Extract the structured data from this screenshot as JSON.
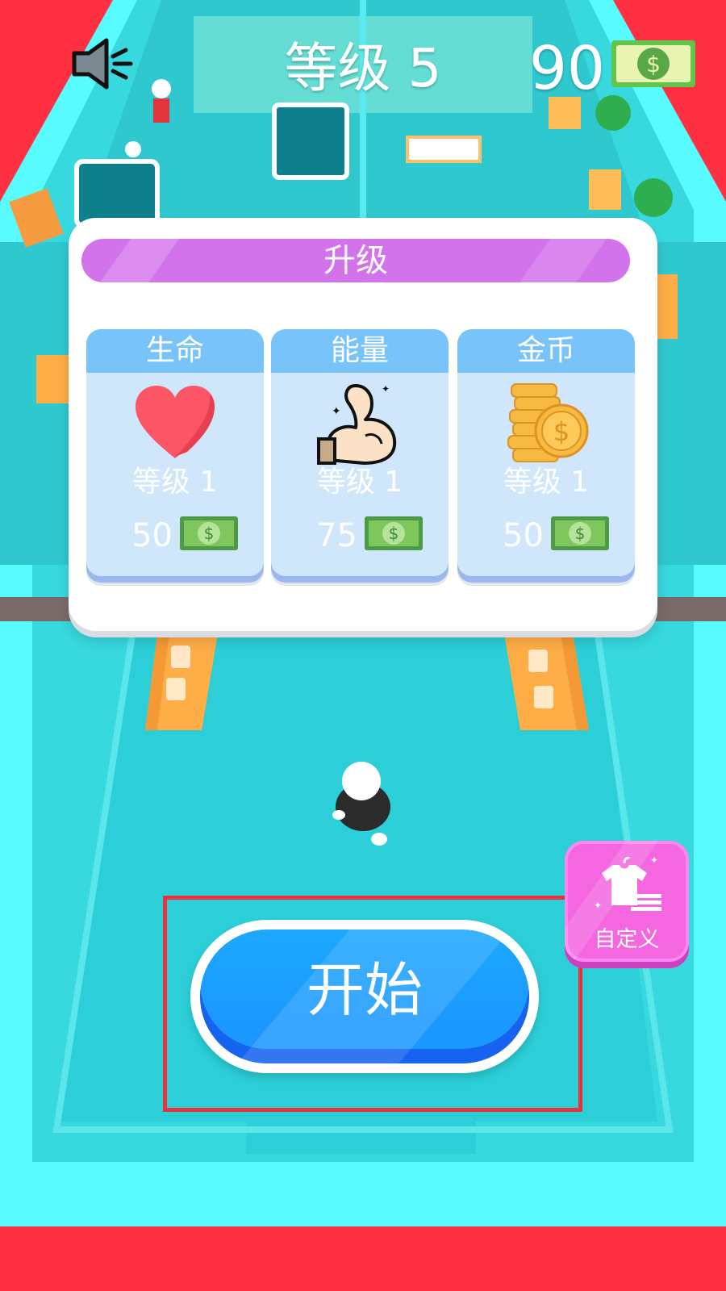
{
  "hud": {
    "sound_icon": "speaker-icon",
    "level_title": "等级 5",
    "coins": "90",
    "currency_icon": "cash-bill-icon"
  },
  "upgrade_panel": {
    "title": "升级",
    "cards": [
      {
        "title": "生命",
        "icon": "heart-icon",
        "level": "等级 1",
        "cost": "50"
      },
      {
        "title": "能量",
        "icon": "flexed-arm-icon",
        "level": "等级 1",
        "cost": "75"
      },
      {
        "title": "金币",
        "icon": "coin-stack-icon",
        "level": "等级 1",
        "cost": "50"
      }
    ]
  },
  "start_button": {
    "label": "开始"
  },
  "customize_button": {
    "label": "自定义",
    "icon": "shirt-icon"
  },
  "colors": {
    "side_red": "#ff3042",
    "floor_cyan": "#2ccfd8",
    "panel_header": "#d373ec",
    "card_header": "#79c3fb",
    "card_body": "#cfe6fb",
    "start_blue": "#1ca8ff",
    "customize_pink": "#f467e0",
    "highlight_red": "#e8333c"
  }
}
